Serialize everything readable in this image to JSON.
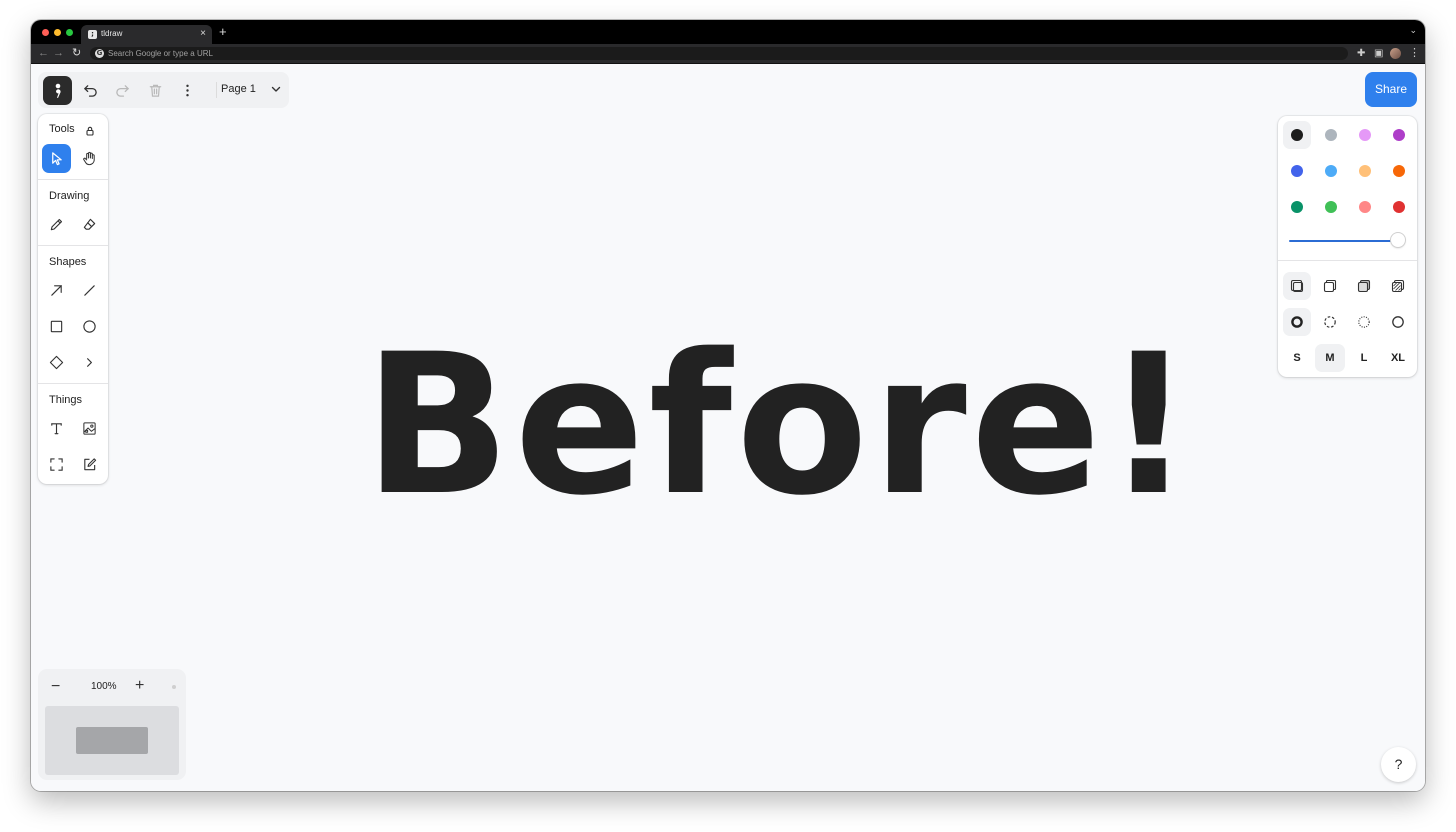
{
  "browser": {
    "tab_title": "tldraw",
    "tab_favicon": "tldraw-logo-icon",
    "omnibox_placeholder": "Search Google or type a URL",
    "new_tab_label": "+",
    "tab_close_label": "×"
  },
  "menu_bar": {
    "page_name": "Page 1",
    "icons": [
      "tldraw-logo-icon",
      "undo-icon",
      "redo-icon",
      "trash-icon",
      "more-vertical-icon",
      "chevron-down-icon"
    ]
  },
  "tools": {
    "title": "Tools",
    "sections": {
      "drawing": "Drawing",
      "shapes": "Shapes",
      "things": "Things"
    },
    "active_tool": "select",
    "items": [
      "select-icon",
      "hand-icon",
      "pencil-icon",
      "eraser-icon",
      "arrow-icon",
      "line-icon",
      "rectangle-icon",
      "ellipse-icon",
      "diamond-icon",
      "chevron-right-icon",
      "text-icon",
      "image-icon",
      "frame-icon",
      "sticky-note-icon"
    ]
  },
  "share": {
    "label": "Share"
  },
  "style_panel": {
    "colors": [
      "#1d1d1d",
      "#adb5bd",
      "#e599f7",
      "#ae3ec9",
      "#4263eb",
      "#4dabf7",
      "#ffc078",
      "#f76707",
      "#099268",
      "#40c057",
      "#ff8787",
      "#e03131"
    ],
    "selected_color": "#1d1d1d",
    "opacity": 1.0,
    "fill_options": [
      "fill-none-icon",
      "fill-semi-icon",
      "fill-solid-icon",
      "fill-pattern-icon"
    ],
    "dash_options": [
      "dash-draw-icon",
      "dash-dashed-icon",
      "dash-dotted-icon",
      "dash-solid-icon"
    ],
    "sizes": [
      "S",
      "M",
      "L",
      "XL"
    ],
    "selected_size": "M"
  },
  "canvas": {
    "text": "Before!"
  },
  "zoom": {
    "level": "100%",
    "minus_label": "−",
    "plus_label": "+"
  },
  "help": {
    "label": "?"
  }
}
